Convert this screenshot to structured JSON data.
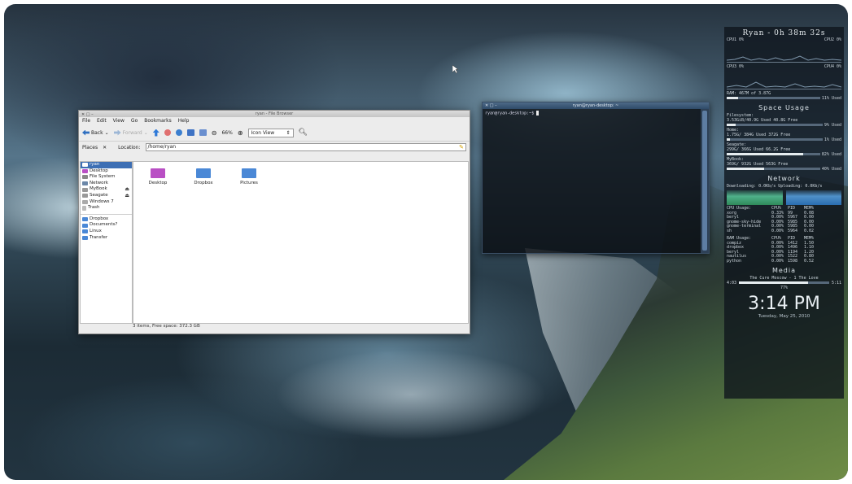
{
  "file_manager": {
    "title": "ryan - File Browser",
    "window_buttons": "✕ □ –",
    "menu": [
      "File",
      "Edit",
      "View",
      "Go",
      "Bookmarks",
      "Help"
    ],
    "toolbar": {
      "back": "Back",
      "forward": "Forward",
      "zoom": "66%",
      "view_mode": "Icon View"
    },
    "places_label": "Places",
    "location_label": "Location:",
    "location_value": "/home/ryan",
    "sidebar": [
      {
        "label": "ryan",
        "selected": true
      },
      {
        "label": "Desktop"
      },
      {
        "label": "File System"
      },
      {
        "label": "Network"
      },
      {
        "label": "MyBook",
        "eject": true
      },
      {
        "label": "Seagate",
        "eject": true
      },
      {
        "label": "Windows 7"
      },
      {
        "label": "Trash"
      }
    ],
    "bookmarks": [
      "Dropbox",
      "Documents?",
      "Linux",
      "Transfer"
    ],
    "files": [
      "Desktop",
      "Dropbox",
      "Pictures"
    ],
    "status": "3 items, Free space: 372.3 GB"
  },
  "terminal": {
    "title": "ryan@ryan-desktop: ~",
    "window_buttons": "✕ □ –",
    "prompt": "ryan@ryan-desktop:~$"
  },
  "conky": {
    "title": "Ryan - 0h 38m 32s",
    "cpu": [
      "CPU1 0%",
      "CPU2 0%",
      "CPU3 0%",
      "CPU4 0%"
    ],
    "ram": "RAM: 467M of 3.87G",
    "ram_pct": "11% Used",
    "ram_fraction": 0.12,
    "space_title": "Space Usage",
    "drives": [
      {
        "name": "Filesystem:",
        "used": "3.53GiB/40.9G Used",
        "free": "40.8G Free",
        "pct": "9% Used",
        "fraction": 0.09
      },
      {
        "name": "Home:",
        "used": "1.75G/ 384G Used",
        "free": "372G Free",
        "pct": "1% Used",
        "fraction": 0.03
      },
      {
        "name": "Seagate:",
        "used": "299G/ 366G Used",
        "free": "66.2G Free",
        "pct": "82% Used",
        "fraction": 0.82
      },
      {
        "name": "MyBook:",
        "used": "369G/ 932G Used",
        "free": "563G Free",
        "pct": "40% Used",
        "fraction": 0.4
      }
    ],
    "network_title": "Network",
    "network_speeds": "Downloading: 0.0Kb/s   Uploading: 0.0Kb/s",
    "cpu_usage_header": [
      "CPU Usage:",
      "CPU%",
      "PID",
      "MEM%"
    ],
    "cpu_procs": [
      [
        "xorg",
        "0.33%",
        "99",
        "0.08"
      ],
      [
        "beryl",
        "0.00%",
        "5967",
        "0.00"
      ],
      [
        "gnome-sky-hide",
        "0.00%",
        "5985",
        "0.00"
      ],
      [
        "gnome-terminal",
        "0.00%",
        "5985",
        "0.00"
      ],
      [
        "sh",
        "0.00%",
        "5964",
        "0.02"
      ]
    ],
    "ram_usage_header": [
      "RAM Usage:",
      "CPU%",
      "PID",
      "MEM%"
    ],
    "ram_procs": [
      [
        "compiz",
        "0.00%",
        "1412",
        "1.50"
      ],
      [
        "dropbox",
        "0.00%",
        "1496",
        "1.10"
      ],
      [
        "beryl",
        "0.00%",
        "1194",
        "1.20"
      ],
      [
        "nautilus",
        "0.00%",
        "1522",
        "0.80"
      ],
      [
        "python",
        "0.00%",
        "1598",
        "0.52"
      ]
    ],
    "media_title": "Media",
    "media_track": "The Cure Moscow - 1 The Love",
    "media_elapsed": "4:03",
    "media_total": "5:11",
    "media_fraction": 0.77,
    "media_pct": "77%",
    "clock": "3:14 PM",
    "date": "Tuesday, May 25, 2010"
  },
  "colors": {
    "selection": "#3d6fb4",
    "folder_blue": "#4a88d6",
    "desktop_folder": "#b94fc4",
    "terminal_title": "#2f4b69"
  }
}
